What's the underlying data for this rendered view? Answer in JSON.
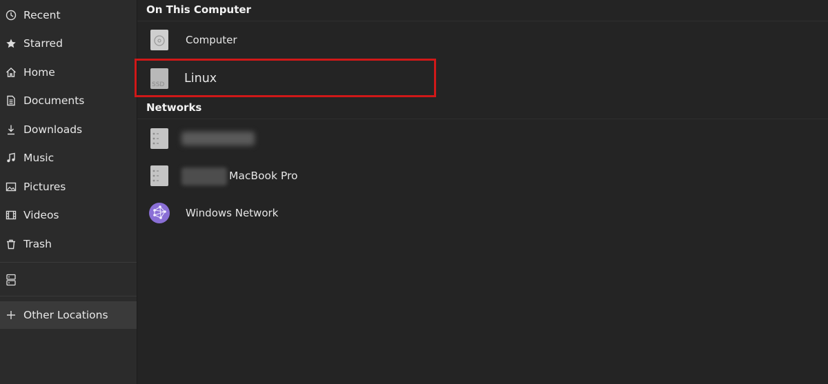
{
  "sidebar": {
    "items": [
      {
        "label": "Recent",
        "icon": "clock-icon"
      },
      {
        "label": "Starred",
        "icon": "star-icon"
      },
      {
        "label": "Home",
        "icon": "home-icon"
      },
      {
        "label": "Documents",
        "icon": "document-icon"
      },
      {
        "label": "Downloads",
        "icon": "download-icon"
      },
      {
        "label": "Music",
        "icon": "music-icon"
      },
      {
        "label": "Pictures",
        "icon": "picture-icon"
      },
      {
        "label": "Videos",
        "icon": "video-icon"
      },
      {
        "label": "Trash",
        "icon": "trash-icon"
      }
    ],
    "server_icon": "server-icon",
    "other_locations": {
      "label": "Other Locations",
      "icon": "plus-icon",
      "active": true
    }
  },
  "main": {
    "on_this_computer": {
      "title": "On This Computer",
      "items": [
        {
          "label": "Computer",
          "icon": "disk-icon"
        },
        {
          "label": "Linux",
          "icon": "ssd-icon",
          "icon_text": "SSD"
        }
      ]
    },
    "networks": {
      "title": "Networks",
      "items": [
        {
          "label": "",
          "icon": "network-server-icon",
          "redacted": true
        },
        {
          "label": "MacBook Pro",
          "icon": "network-server-icon",
          "redacted_prefix": true
        },
        {
          "label": "Windows Network",
          "icon": "network-globe-icon"
        }
      ]
    }
  },
  "colors": {
    "background": "#242424",
    "sidebar": "#2b2b2b",
    "highlight_border": "#d01818",
    "globe": "#8a6fd6"
  }
}
